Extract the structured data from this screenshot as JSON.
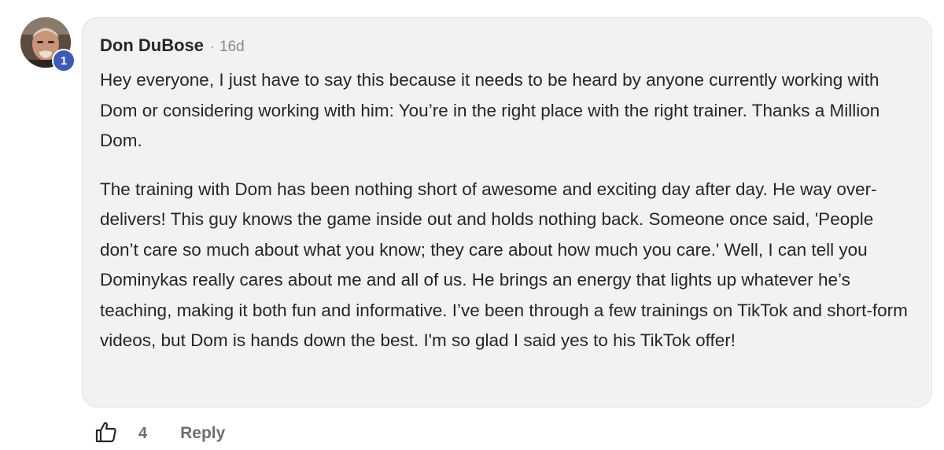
{
  "comment": {
    "author": "Don DuBose",
    "separator": "·",
    "timestamp": "16d",
    "level": "1",
    "paragraphs": [
      "Hey everyone, I just have to say this because it needs to be heard by anyone currently working with Dom or considering working with him: You’re in the right place with the right trainer. Thanks a Million Dom.",
      "The training with Dom has been nothing short of awesome and exciting day after day. He way over-delivers! This guy knows the game inside out and holds nothing back. Someone once said, 'People don’t care so much about what you know; they care about how much you care.' Well, I can tell you Dominykas really cares about me and all of us. He brings an energy that lights up whatever he’s teaching, making it both fun and informative. I’ve been through a few trainings on TikTok and short-form videos, but Dom is hands down the best. I'm so glad I said yes to his TikTok offer!"
    ]
  },
  "actions": {
    "like_icon": "thumbs-up-icon",
    "like_count": "4",
    "reply_label": "Reply"
  },
  "colors": {
    "bubble_background": "#f2f2f2",
    "badge": "#3f59b5",
    "text": "#262626",
    "muted": "#6e6e6e"
  }
}
